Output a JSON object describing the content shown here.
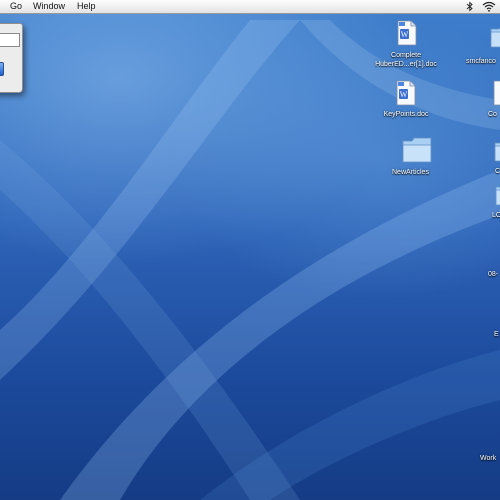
{
  "menubar": {
    "items": [
      "Go",
      "Window",
      "Help"
    ],
    "status_icons": [
      "bluetooth-icon",
      "wifi-icon"
    ]
  },
  "partial_window": {
    "field_value": "",
    "button_label": ""
  },
  "desktop": {
    "items": [
      {
        "label_line1": "Complete",
        "label_line2": "HuberED...er[1].doc",
        "icon": "word-document-icon"
      },
      {
        "label_line1": "smcfanco",
        "label_line2": "",
        "icon": "folder-icon"
      },
      {
        "label_line1": "KeyPoints.doc",
        "label_line2": "",
        "icon": "word-document-icon"
      },
      {
        "label_line1": "Co",
        "label_line2": "",
        "icon": "document-icon"
      },
      {
        "label_line1": "NewArticles",
        "label_line2": "",
        "icon": "folder-icon"
      },
      {
        "label_line1": "C",
        "label_line2": "",
        "icon": "folder-icon"
      },
      {
        "label_line1": "LO",
        "label_line2": "",
        "icon": "folder-icon"
      },
      {
        "label_line1": "08-",
        "label_line2": "",
        "icon": ""
      },
      {
        "label_line1": "E",
        "label_line2": "",
        "icon": ""
      },
      {
        "label_line1": "Work",
        "label_line2": "",
        "icon": ""
      }
    ]
  }
}
